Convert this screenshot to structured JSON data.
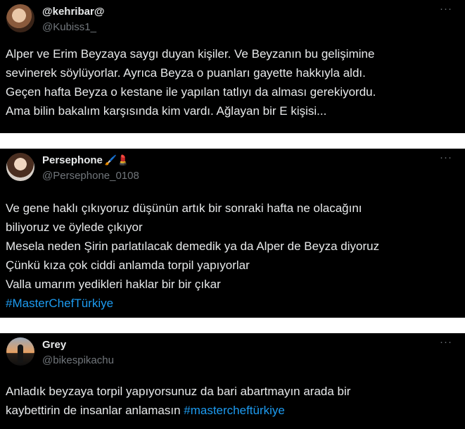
{
  "tweets": [
    {
      "name": "@kehribar@",
      "name_emoji": "",
      "handle": "@Kubiss1_",
      "more": "···",
      "lines": [
        "Alper ve Erim Beyzaya saygı duyan kişiler. Ve Beyzanın bu gelişimine",
        "sevinerek söylüyorlar. Ayrıca Beyza o puanları gayette hakkıyla aldı.",
        "Geçen hafta Beyza o kestane ile yapılan tatlıyı da alması gerekiyordu.",
        "Ama bilin bakalım karşısında kim vardı. Ağlayan bir E kişisi..."
      ],
      "hashtag_line": ""
    },
    {
      "name": "Persephone",
      "name_emoji": "🖌️💄",
      "handle": "@Persephone_0108",
      "more": "···",
      "lines": [
        "Ve gene haklı çıkıyoruz düşünün artık bir sonraki hafta ne olacağını",
        "biliyoruz ve öylede çıkıyor",
        "Mesela neden Şirin parlatılacak demedik ya da Alper de Beyza diyoruz",
        "Çünkü kıza çok ciddi anlamda torpil yapıyorlar",
        "Valla umarım yedikleri haklar bir bir çıkar"
      ],
      "hashtag_line": "#MasterChefTürkiye"
    },
    {
      "name": "Grey",
      "name_emoji": "",
      "handle": "@bikespikachu",
      "more": "···",
      "lines": [
        "Anladık beyzaya torpil yapıyorsunuz da bari abartmayın arada bir"
      ],
      "last_line_text": "kaybettirin de insanlar anlamasın ",
      "last_line_hashtag": "#mastercheftürkiye"
    }
  ],
  "colors": {
    "background": "#000000",
    "text": "#e7e9ea",
    "muted": "#71767b",
    "hashtag": "#1d9bf0",
    "separator": "#ffffff"
  },
  "icons": [
    "avatar-photo",
    "more-options-icon",
    "paintbrush-emoji",
    "lipstick-emoji"
  ]
}
